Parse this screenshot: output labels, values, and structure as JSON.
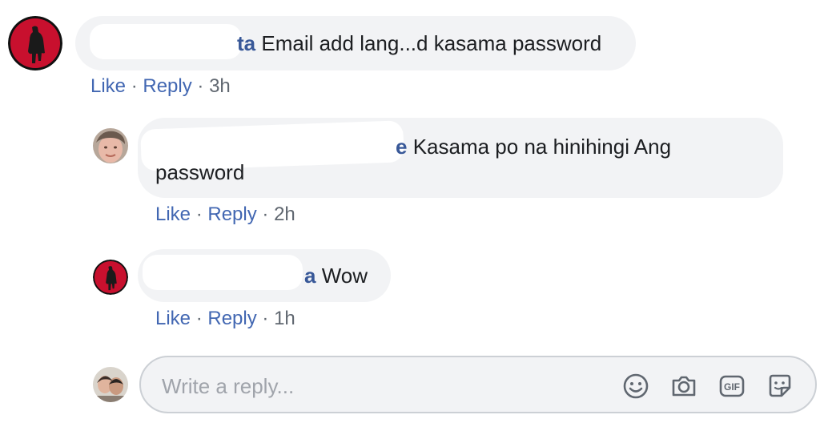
{
  "comments": [
    {
      "name_tail": "ta",
      "text": "Email add lang...d kasama password",
      "actions": {
        "like": "Like",
        "sep": "·",
        "reply": "Reply",
        "time": "3h"
      },
      "avatar": "red-silhouette-avatar"
    },
    {
      "name_tail": "e",
      "text_line1": "Kasama po na hinihingi Ang",
      "text_line2": "password",
      "actions": {
        "like": "Like",
        "sep": "·",
        "reply": "Reply",
        "time": "2h"
      },
      "avatar": "photo-avatar"
    },
    {
      "name_tail": "a",
      "text": "Wow",
      "actions": {
        "like": "Like",
        "sep": "·",
        "reply": "Reply",
        "time": "1h"
      },
      "avatar": "red-silhouette-avatar"
    }
  ],
  "composer": {
    "placeholder": "Write a reply...",
    "icons": [
      "emoji-icon",
      "camera-icon",
      "gif-icon",
      "sticker-icon"
    ]
  },
  "colors": {
    "bubble": "#f2f3f5",
    "name": "#385898",
    "link": "#4267b2",
    "meta": "#606770",
    "avatar_red": "#c8102e"
  }
}
